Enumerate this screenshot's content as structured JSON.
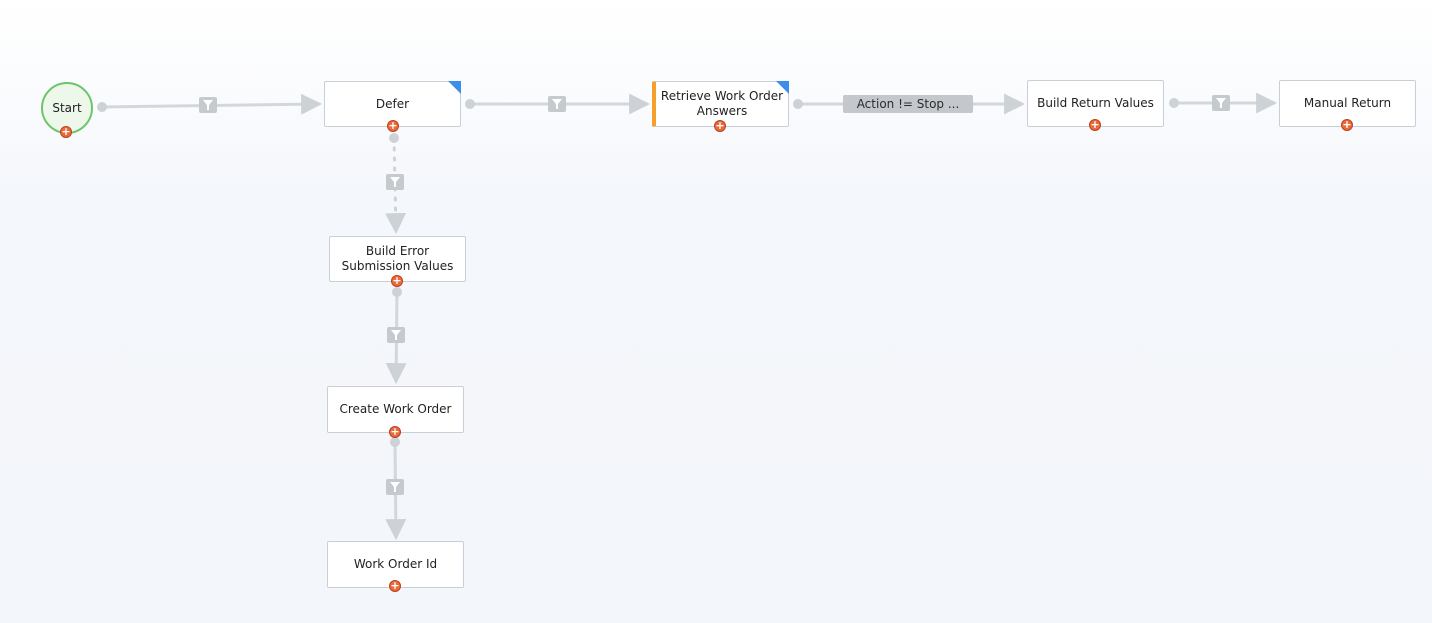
{
  "workflow": {
    "nodes": {
      "start": "Start",
      "defer": "Defer",
      "retrieve": "Retrieve Work Order Answers",
      "build_return": "Build Return Values",
      "manual_return": "Manual Return",
      "build_error": "Build Error Submission Values",
      "create_work_order": "Create Work Order",
      "work_order_id": "Work Order Id"
    },
    "connector_condition": "Action != Stop ...",
    "icons": {
      "add": "plus-circle-icon",
      "filter": "filter-icon",
      "corner_flag": "corner-flag-icon"
    },
    "colors": {
      "start_fill": "#edf8ea",
      "start_border": "#6ec46a",
      "add_button": "#ea6a3a",
      "corner_flag": "#3d8ee8",
      "accent_bar": "#f3a02c",
      "connector": "#d3d7dc"
    }
  }
}
